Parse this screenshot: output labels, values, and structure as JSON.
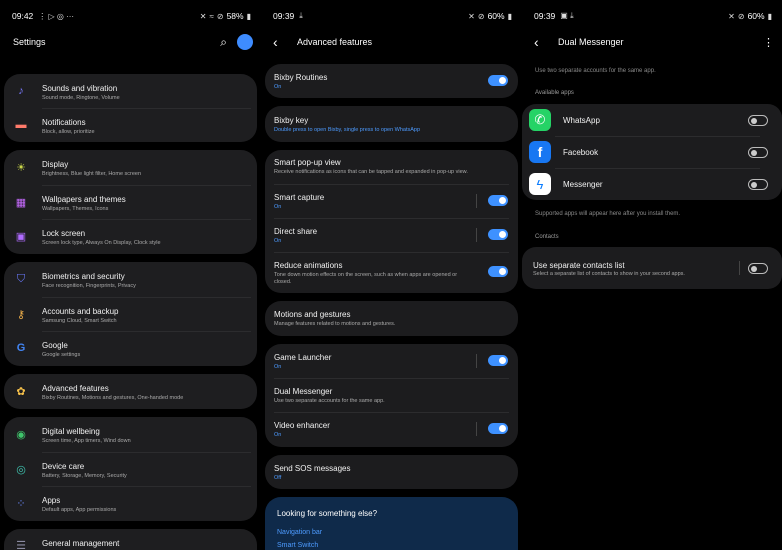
{
  "screen1": {
    "status": {
      "time": "09:42",
      "battery": "58%"
    },
    "title": "Settings",
    "items": [
      {
        "label": "Sounds and vibration",
        "sub": "Sound mode, Ringtone, Volume",
        "icon": "speaker-icon",
        "color": "#7a7aff"
      },
      {
        "label": "Notifications",
        "sub": "Block, allow, prioritize",
        "icon": "notifications-icon",
        "color": "#ff7b6b"
      },
      {
        "label": "Display",
        "sub": "Brightness, Blue light filter, Home screen",
        "icon": "sun-icon",
        "color": "#c9d64a"
      },
      {
        "label": "Wallpapers and themes",
        "sub": "Wallpapers, Themes, Icons",
        "icon": "paintbrush-icon",
        "color": "#c86bff"
      },
      {
        "label": "Lock screen",
        "sub": "Screen lock type, Always On Display, Clock style",
        "icon": "lock-icon",
        "color": "#b06bff"
      },
      {
        "label": "Biometrics and security",
        "sub": "Face recognition, Fingerprints, Privacy",
        "icon": "shield-icon",
        "color": "#6b7bff"
      },
      {
        "label": "Accounts and backup",
        "sub": "Samsung Cloud, Smart Switch",
        "icon": "key-icon",
        "color": "#f0b04a"
      },
      {
        "label": "Google",
        "sub": "Google settings",
        "icon": "google-icon",
        "color": "#4285f4"
      },
      {
        "label": "Advanced features",
        "sub": "Bixby Routines, Motions and gestures, One-handed mode",
        "icon": "puzzle-icon",
        "color": "#f5c04a"
      },
      {
        "label": "Digital wellbeing",
        "sub": "Screen time, App timers, Wind down",
        "icon": "wellbeing-icon",
        "color": "#3fc46b"
      },
      {
        "label": "Device care",
        "sub": "Battery, Storage, Memory, Security",
        "icon": "device-care-icon",
        "color": "#3fc4b0"
      },
      {
        "label": "Apps",
        "sub": "Default apps, App permissions",
        "icon": "apps-icon",
        "color": "#6b8bff"
      },
      {
        "label": "General management",
        "sub": "",
        "icon": "sliders-icon",
        "color": "#8a8aa0"
      }
    ]
  },
  "screen2": {
    "status": {
      "time": "09:39",
      "battery": "60%"
    },
    "title": "Advanced features",
    "items": [
      {
        "label": "Bixby Routines",
        "sub": "On"
      },
      {
        "label": "Bixby key",
        "sub": "Double press to open Bixby, single press to open WhatsApp"
      },
      {
        "label": "Smart pop-up view",
        "sub": "Receive notifications as icons that can be tapped and expanded in pop-up view."
      },
      {
        "label": "Smart capture",
        "sub": "On"
      },
      {
        "label": "Direct share",
        "sub": "On"
      },
      {
        "label": "Reduce animations",
        "sub": "Tone down motion effects on the screen, such as when apps are opened or closed."
      },
      {
        "label": "Motions and gestures",
        "sub": "Manage features related to motions and gestures."
      },
      {
        "label": "Game Launcher",
        "sub": "On"
      },
      {
        "label": "Dual Messenger",
        "sub": "Use two separate accounts for the same app."
      },
      {
        "label": "Video enhancer",
        "sub": "On"
      },
      {
        "label": "Send SOS messages",
        "sub": "Off"
      }
    ],
    "looking": {
      "title": "Looking for something else?",
      "links": [
        "Navigation bar",
        "Smart Switch"
      ]
    }
  },
  "screen3": {
    "status": {
      "time": "09:39",
      "battery": "60%"
    },
    "title": "Dual Messenger",
    "intro": "Use two separate accounts for the same app.",
    "available_label": "Available apps",
    "apps": [
      {
        "label": "WhatsApp",
        "icon": "whatsapp-icon",
        "color": "#25d366"
      },
      {
        "label": "Facebook",
        "icon": "facebook-icon",
        "color": "#1877f2"
      },
      {
        "label": "Messenger",
        "icon": "messenger-icon",
        "color": "#0a7cff"
      }
    ],
    "supported_note": "Supported apps will appear here after you install them.",
    "contacts_label": "Contacts",
    "contacts": {
      "label": "Use separate contacts list",
      "sub": "Select a separate list of contacts to show in your second apps."
    }
  }
}
